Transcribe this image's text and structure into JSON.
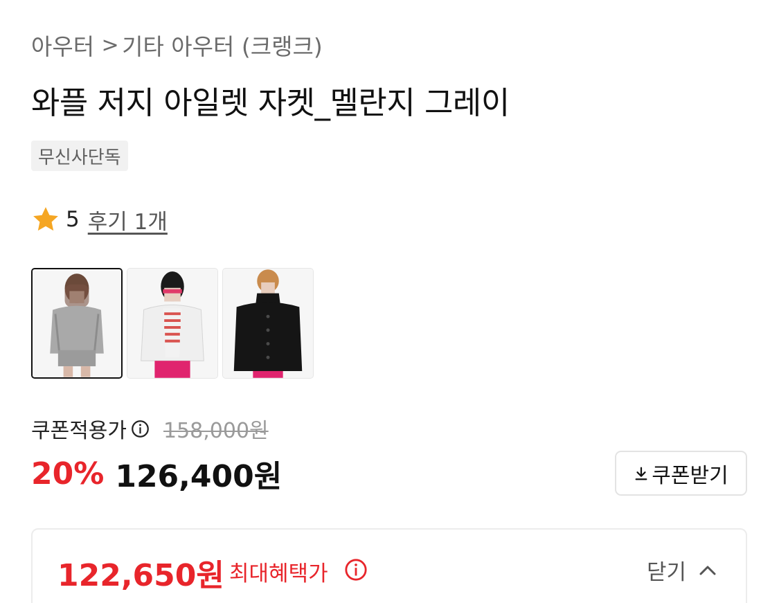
{
  "breadcrumb": {
    "category": "아우터",
    "separator": ">",
    "subcategory": "기타 아우터 (크랭크)"
  },
  "product": {
    "title": "와플 저지 아일렛 자켓_멜란지 그레이",
    "badge": "무신사단독"
  },
  "rating": {
    "score": "5",
    "reviews_label": "후기 1개",
    "star_color": "#f5a623"
  },
  "gallery": {
    "thumbnails": [
      {
        "name": "grey-melange-jacket",
        "selected": true
      },
      {
        "name": "white-jacket",
        "selected": false
      },
      {
        "name": "black-jacket",
        "selected": false
      }
    ]
  },
  "pricing": {
    "coupon_label": "쿠폰적용가",
    "original_price": "158,000원",
    "discount_rate": "20%",
    "sale_price": "126,400원",
    "coupon_button_label": "쿠폰받기",
    "accent_color": "#e8252b"
  },
  "benefit": {
    "max_price": "122,650원",
    "max_label": "최대혜택가",
    "collapse_label": "닫기"
  },
  "icons": {
    "star": "star-icon",
    "info": "info-icon",
    "download": "download-icon",
    "chevron_up": "chevron-up-icon"
  }
}
